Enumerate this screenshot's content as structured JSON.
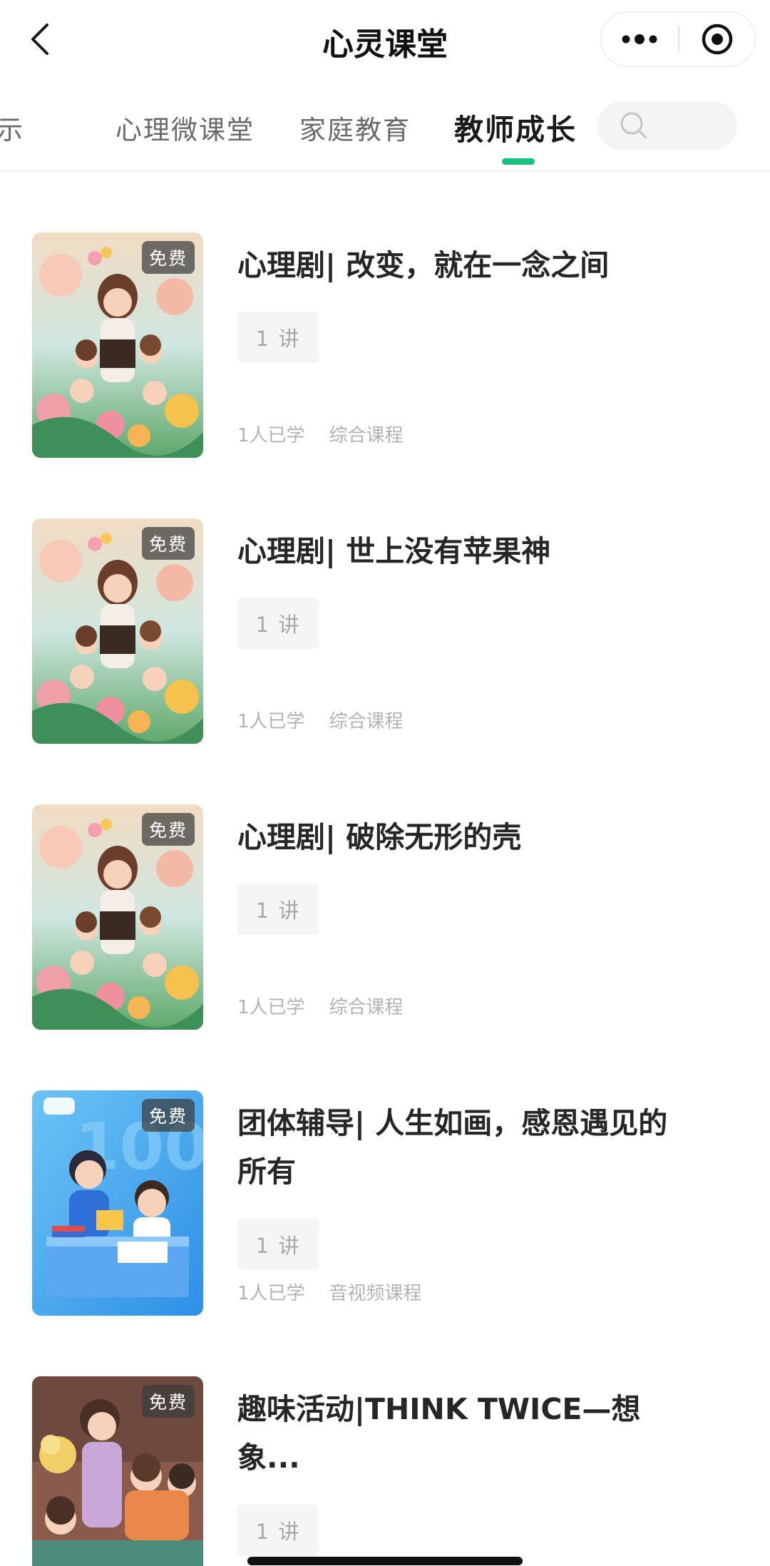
{
  "header": {
    "title": "心灵课堂",
    "back_icon": "chevron-left-icon",
    "more_icon": "more-dots-icon",
    "close_icon": "target-close-icon"
  },
  "tabs": [
    {
      "label": "展示",
      "active": false
    },
    {
      "label": "心理微课堂",
      "active": false
    },
    {
      "label": "家庭教育",
      "active": false
    },
    {
      "label": "教师成长",
      "active": true
    }
  ],
  "search": {
    "icon": "search-icon"
  },
  "accent_color": "#17c27e",
  "courses": [
    {
      "badge": "免费",
      "title": "心理剧| 改变，就在一念之间",
      "lectures": "1 讲",
      "learners": "1人已学",
      "category": "综合课程",
      "cover": "teacher-children-illustration"
    },
    {
      "badge": "免费",
      "title": "心理剧| 世上没有苹果神",
      "lectures": "1 讲",
      "learners": "1人已学",
      "category": "综合课程",
      "cover": "teacher-children-illustration"
    },
    {
      "badge": "免费",
      "title": "心理剧| 破除无形的壳",
      "lectures": "1 讲",
      "learners": "1人已学",
      "category": "综合课程",
      "cover": "teacher-children-illustration"
    },
    {
      "badge": "免费",
      "title": "团体辅导| 人生如画，感恩遇见的所有",
      "lectures": "1 讲",
      "learners": "1人已学",
      "category": "音视频课程",
      "cover": "teacher-student-desk-illustration"
    },
    {
      "badge": "免费",
      "title": "趣味活动|THINK TWICE—想象...",
      "lectures": "1 讲",
      "cover": "teacher-classroom-illustration"
    }
  ]
}
